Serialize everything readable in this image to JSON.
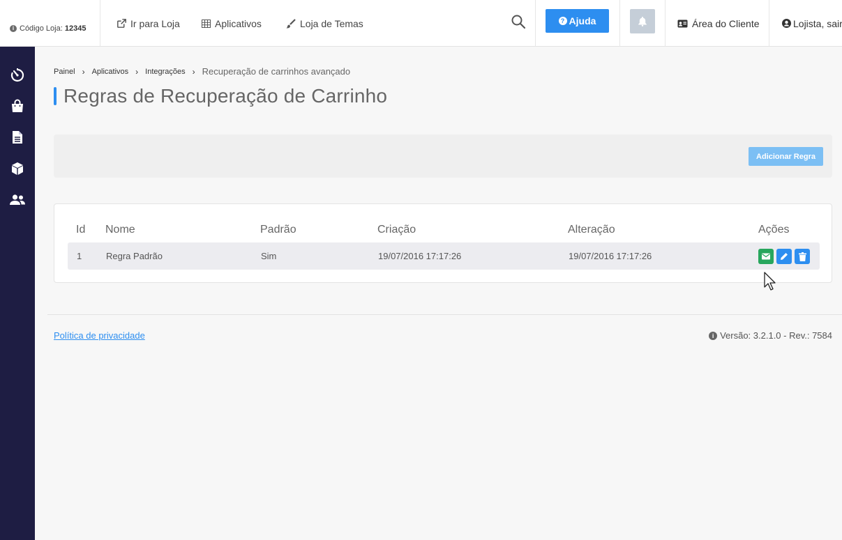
{
  "header": {
    "store_code_label": "Código Loja:",
    "store_code_value": "12345",
    "nav": {
      "ir_para_loja": "Ir para Loja",
      "aplicativos": "Aplicativos",
      "loja_de_temas": "Loja de Temas"
    },
    "help_label": "Ajuda",
    "area_cliente_label": "Área do Cliente",
    "user_label": "Lojista, sair"
  },
  "sidebar": {
    "items": [
      {
        "icon": "dashboard-timer-icon"
      },
      {
        "icon": "shopping-bag-icon"
      },
      {
        "icon": "document-icon"
      },
      {
        "icon": "box-icon"
      },
      {
        "icon": "users-icon"
      }
    ]
  },
  "breadcrumb": {
    "items": [
      "Painel",
      "Aplicativos",
      "Integrações"
    ],
    "current": "Recuperação de carrinhos avançado"
  },
  "page": {
    "title": "Regras de Recuperação de Carrinho",
    "add_rule_label": "Adicionar Regra"
  },
  "table": {
    "headers": [
      "Id",
      "Nome",
      "Padrão",
      "Criação",
      "Alteração",
      "Ações"
    ],
    "rows": [
      {
        "id": "1",
        "nome": "Regra Padrão",
        "padrao": "Sim",
        "criacao": "19/07/2016 17:17:26",
        "alteracao": "19/07/2016 17:17:26"
      }
    ]
  },
  "footer": {
    "privacy_label": "Política de privacidade",
    "version_label": "Versão: 3.2.1.0 - Rev.: 7584"
  },
  "colors": {
    "accent": "#2d8ef0",
    "sidebar": "#1e1d43",
    "success": "#27a65d"
  }
}
